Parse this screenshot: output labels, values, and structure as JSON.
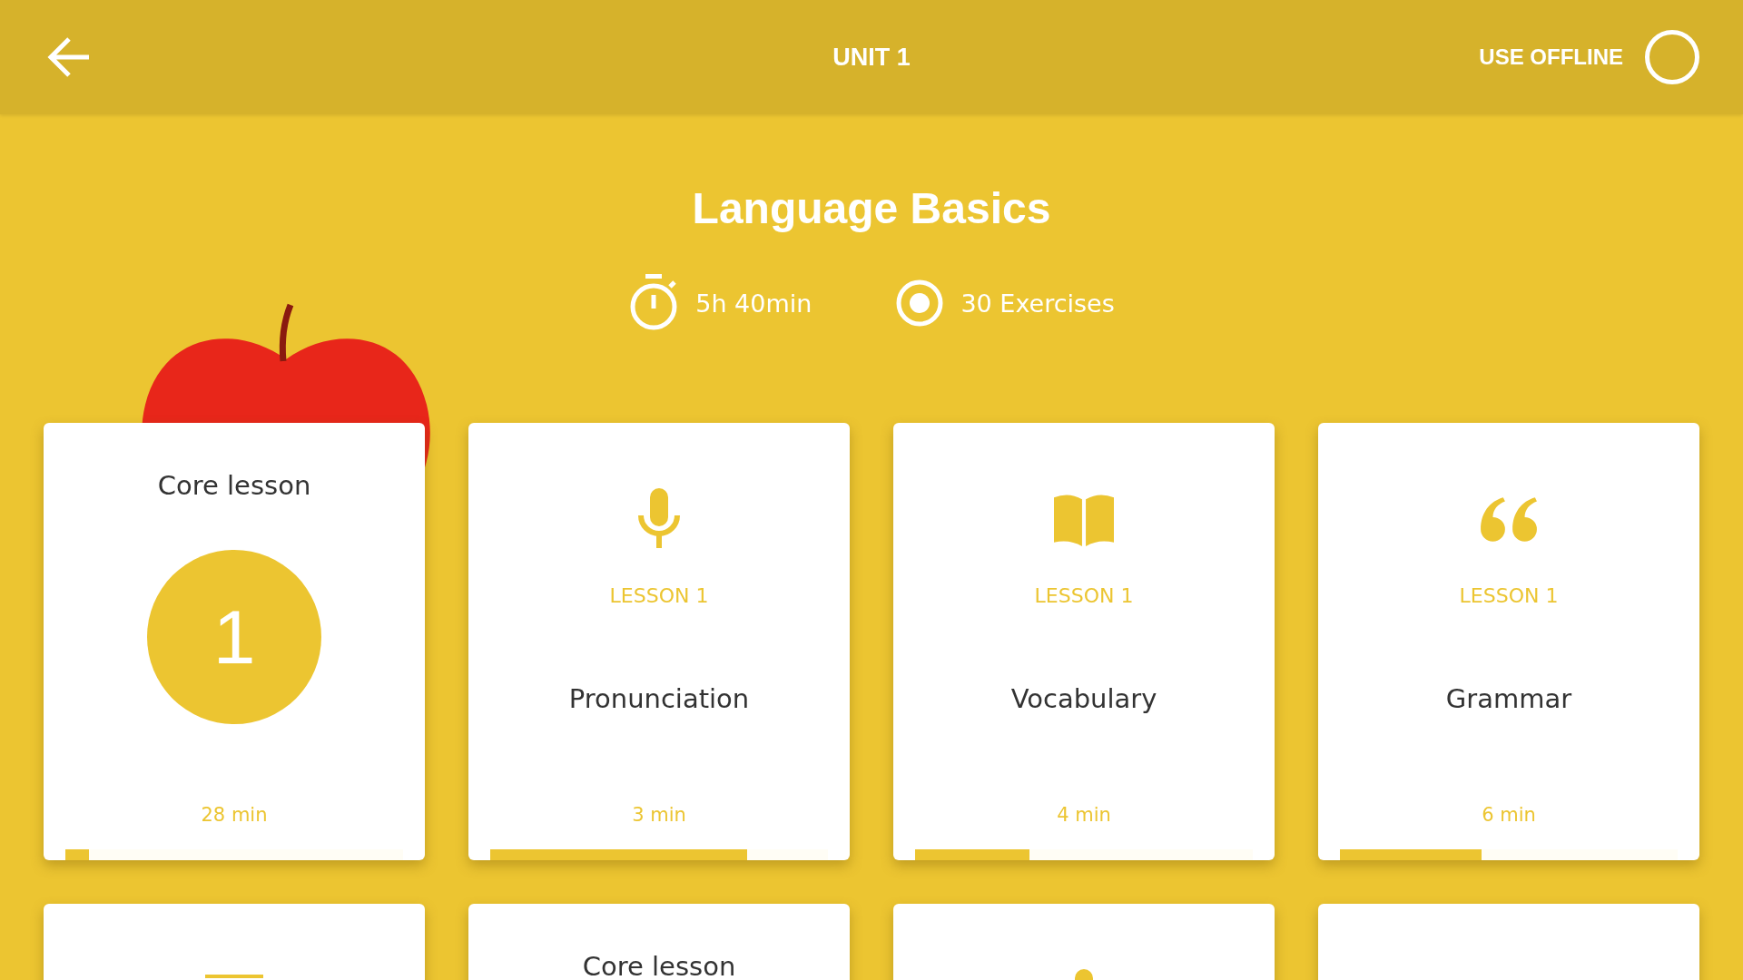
{
  "header": {
    "title": "UNIT 1",
    "offline": {
      "label": "USE OFFLINE",
      "on": false
    }
  },
  "unit": {
    "title": "Language Basics",
    "duration": "5h 40min",
    "exercises": "30 Exercises"
  },
  "cards": [
    {
      "kind": "core",
      "title": "Core lesson",
      "number": "1",
      "duration": "28 min",
      "level": 0.07
    },
    {
      "kind": "pronunciation",
      "label": "LESSON 1",
      "title": "Pronunciation",
      "duration": "3 min",
      "level": 0.76
    },
    {
      "kind": "vocabulary",
      "label": "LESSON 1",
      "title": "Vocabulary",
      "duration": "4 min",
      "level": 0.34
    },
    {
      "kind": "grammar",
      "label": "LESSON 1",
      "title": "Grammar",
      "duration": "6 min",
      "level": 0.42
    },
    {
      "kind": "line"
    },
    {
      "kind": "core",
      "title": "Core lesson"
    },
    {
      "kind": "pronunciation"
    },
    {
      "kind": "blank"
    }
  ]
}
